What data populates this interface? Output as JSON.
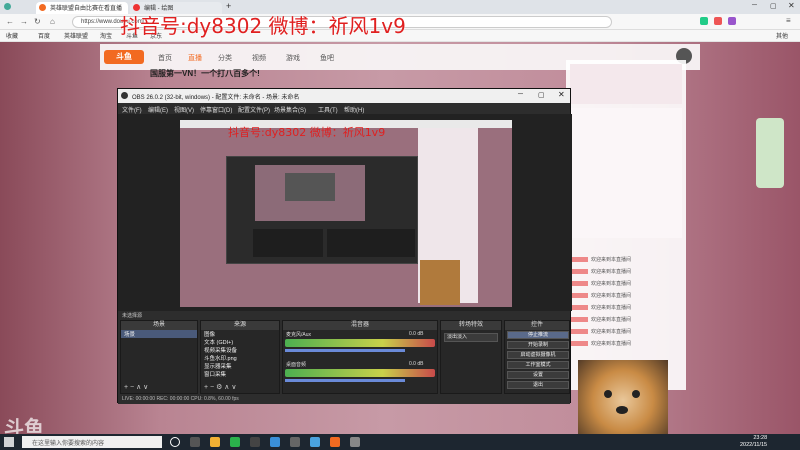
{
  "browser": {
    "tabs": [
      {
        "label": "英雄联盟自由比赛在看直播",
        "icon": "douyu-icon",
        "color": "#f26a21"
      },
      {
        "label": "编辑 - 绘图",
        "icon": "douyu-icon",
        "color": "#e33"
      }
    ],
    "new_tab": "+",
    "url": "https://www.douyu.com/...",
    "bookmarks": [
      "收藏",
      "百度",
      "英雄联盟",
      "淘宝",
      "斗鱼",
      "京东",
      "其他"
    ]
  },
  "watermark": "抖音号:dy8302 微博：祈风1v9",
  "site": {
    "logo": "斗鱼",
    "nav": [
      "首页",
      "直播",
      "分类",
      "视频",
      "游戏",
      "鱼吧"
    ],
    "room_title": "国服第一VN！一个打八百多个!",
    "chat_rows": [
      "欢迎来到本直播间",
      "欢迎来到本直播间",
      "欢迎来到本直播间",
      "欢迎来到本直播间",
      "欢迎来到本直播间",
      "欢迎来到本直播间",
      "欢迎来到本直播间",
      "欢迎来到本直播间"
    ],
    "corner_brand": "斗鱼"
  },
  "obs": {
    "title": "OBS 26.0.2 (32-bit, windows) - 配置文件: 未命名 - 场景: 未命名",
    "menu": [
      "文件(F)",
      "编辑(E)",
      "视图(V)",
      "停靠窗口(D)",
      "配置文件(P)",
      "场景集合(S)",
      "工具(T)",
      "帮助(H)"
    ],
    "preview_watermark": "抖音号:dy8302 微博：祈风1v9",
    "status": "未选择源",
    "docks": {
      "scenes": {
        "title": "场景",
        "items": [
          "场景"
        ]
      },
      "sources": {
        "title": "来源",
        "items": [
          "图像",
          "文本 (GDI+)",
          "视频采集设备",
          "斗鱼水印.png",
          "显示器采集",
          "窗口采集"
        ]
      },
      "mixer": {
        "title": "混音器",
        "channels": [
          {
            "name": "麦克风/Aux",
            "db": "0.0 dB"
          },
          {
            "name": "桌面音频",
            "db": "0.0 dB"
          }
        ]
      },
      "transitions": {
        "title": "转场特效",
        "value": "淡出淡入"
      },
      "controls": {
        "title": "控件",
        "buttons": [
          "停止推流",
          "开始录制",
          "启动虚拟摄像机",
          "工作室模式",
          "设置",
          "退出"
        ]
      }
    },
    "footer": "LIVE: 00:00:00   REC: 00:00:00   CPU: 0.8%, 60.00 fps"
  },
  "taskbar": {
    "search_placeholder": "在这里输入你要搜索的内容",
    "time": "23:28",
    "date": "2022/11/15"
  }
}
